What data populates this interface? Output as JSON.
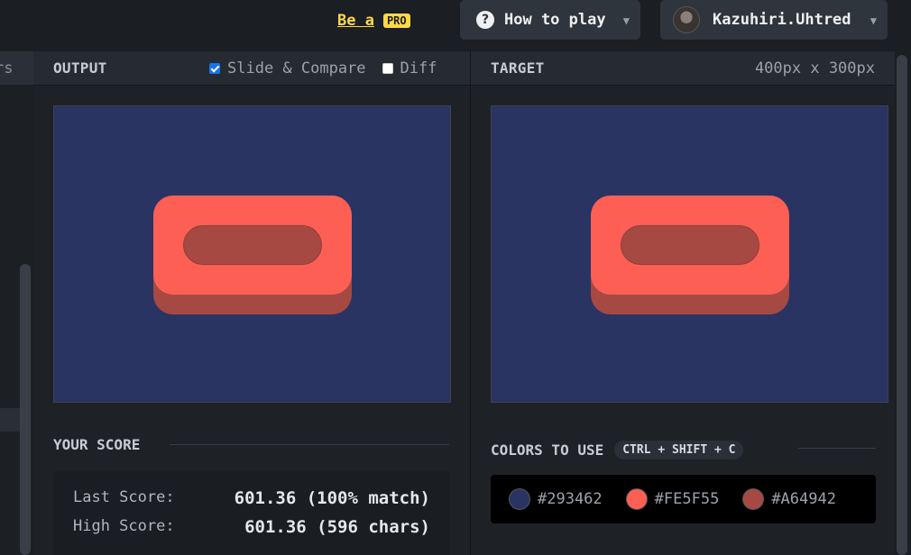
{
  "topbar": {
    "be_a": "Be a",
    "pro": "PRO",
    "how_to_play": "How to play",
    "username": "Kazuhiri.Uhtred"
  },
  "left_tab_fragment": "rs",
  "output_panel": {
    "title": "OUTPUT",
    "slide_compare": "Slide & Compare",
    "slide_compare_checked": true,
    "diff": "Diff",
    "diff_checked": false
  },
  "target_panel": {
    "title": "TARGET",
    "dimensions": "400px x 300px"
  },
  "score": {
    "title": "YOUR SCORE",
    "last_label": "Last Score:",
    "last_value": "601.36 (100% match)",
    "high_label": "High Score:",
    "high_value": "601.36 (596 chars)"
  },
  "colors": {
    "title": "COLORS TO USE",
    "shortcut": "CTRL + SHIFT + C",
    "palette": [
      {
        "code": "#293462",
        "hex": "#293462"
      },
      {
        "code": "#FE5F55",
        "hex": "#FE5F55"
      },
      {
        "code": "#A64942",
        "hex": "#A64942"
      }
    ]
  }
}
